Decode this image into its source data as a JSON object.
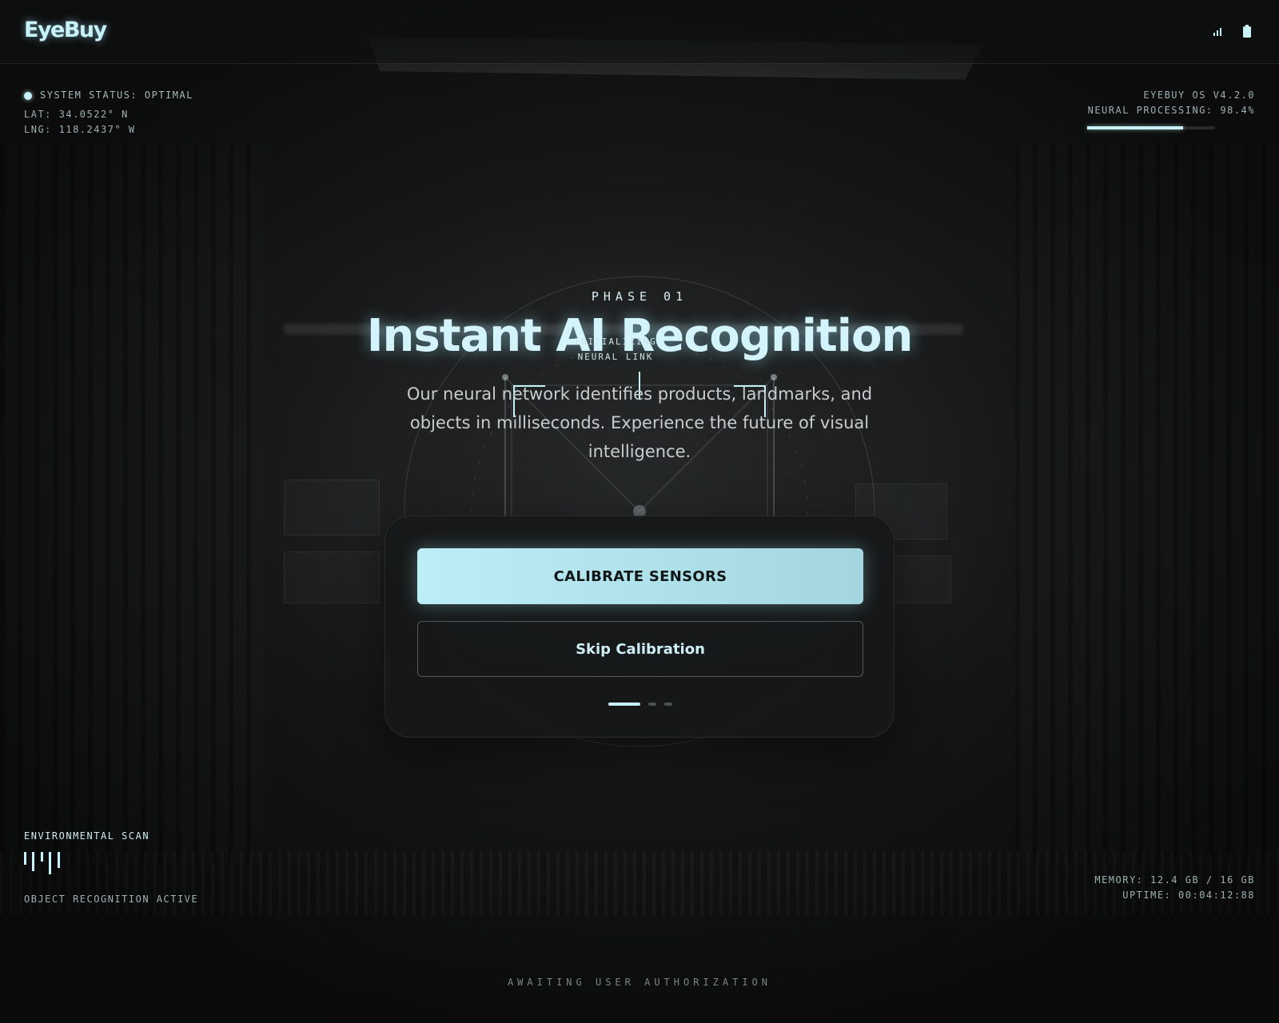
{
  "brand": {
    "name": "EyeBuy",
    "accent": "#c8f2f9"
  },
  "header": {
    "icons": [
      "signal-icon",
      "battery-icon"
    ]
  },
  "hud_top_left": {
    "status": "SYSTEM STATUS: OPTIMAL",
    "lat": "LAT: 34.0522° N",
    "lng": "LNG: 118.2437° W"
  },
  "hud_top_right": {
    "os_version": "EYEBUY OS V4.2.0",
    "neural_processing": "NEURAL PROCESSING: 98.4%",
    "neural_progress": 0.75
  },
  "hero": {
    "phase": "PHASE 01",
    "title": "Instant AI Recognition",
    "scanner_label_line1": "INITIALIZING",
    "scanner_label_line2": "NEURAL LINK",
    "subtitle": "Our neural network identifies products, landmarks, and objects in milliseconds. Experience the future of visual intelligence."
  },
  "card": {
    "primary_label": "CALIBRATE SENSORS",
    "secondary_label": "Skip Calibration",
    "pagination": {
      "total": 3,
      "active": 0
    }
  },
  "hud_bottom_left": {
    "env_label": "ENVIRONMENTAL SCAN",
    "object_recognition": "OBJECT RECOGNITION ACTIVE"
  },
  "hud_bottom_right": {
    "memory": "MEMORY: 12.4 GB / 16 GB",
    "uptime": "UPTIME: 00:04:12:88"
  },
  "footer": {
    "status": "AWAITING USER AUTHORIZATION"
  }
}
